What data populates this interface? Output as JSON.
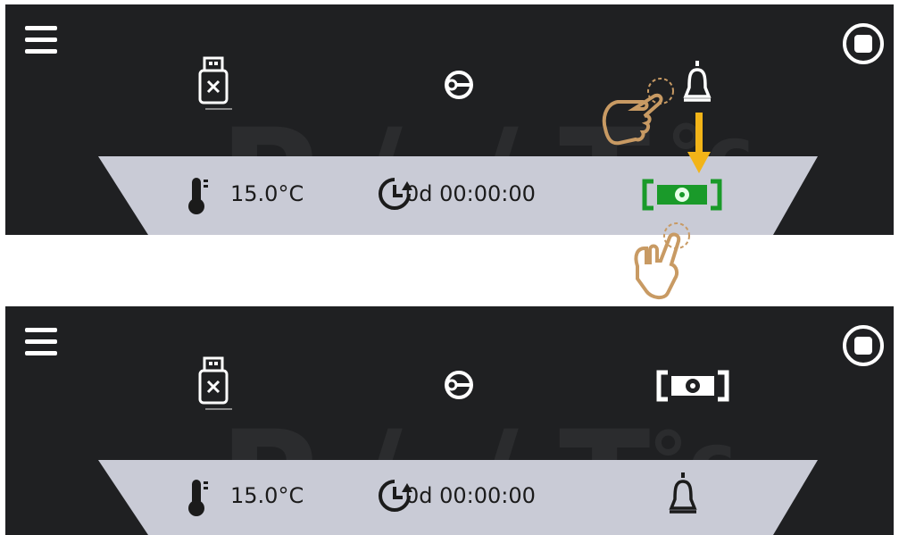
{
  "screens": [
    {
      "id": "top",
      "temperature": "15.0°C",
      "timer": "0d 00:00:00",
      "bg_text": "°c"
    },
    {
      "id": "bottom",
      "temperature": "15.0°C",
      "timer": "0d 00:00:00",
      "bg_text": "°c"
    }
  ],
  "icons": {
    "menu": "hamburger-menu-icon",
    "stop": "stop-button-icon",
    "usb": "usb-disconnected-icon",
    "login": "login-key-icon",
    "alarm": "bell-icon",
    "settings": "settings-gear-icon",
    "thermometer": "thermometer-icon",
    "timer": "clock-timer-icon"
  },
  "colors": {
    "screen_bg": "#1f2022",
    "panel_bg": "#c9cbd6",
    "accent_green": "#1a9a2a",
    "hand": "#c89a63",
    "arrow": "#f2b418"
  }
}
